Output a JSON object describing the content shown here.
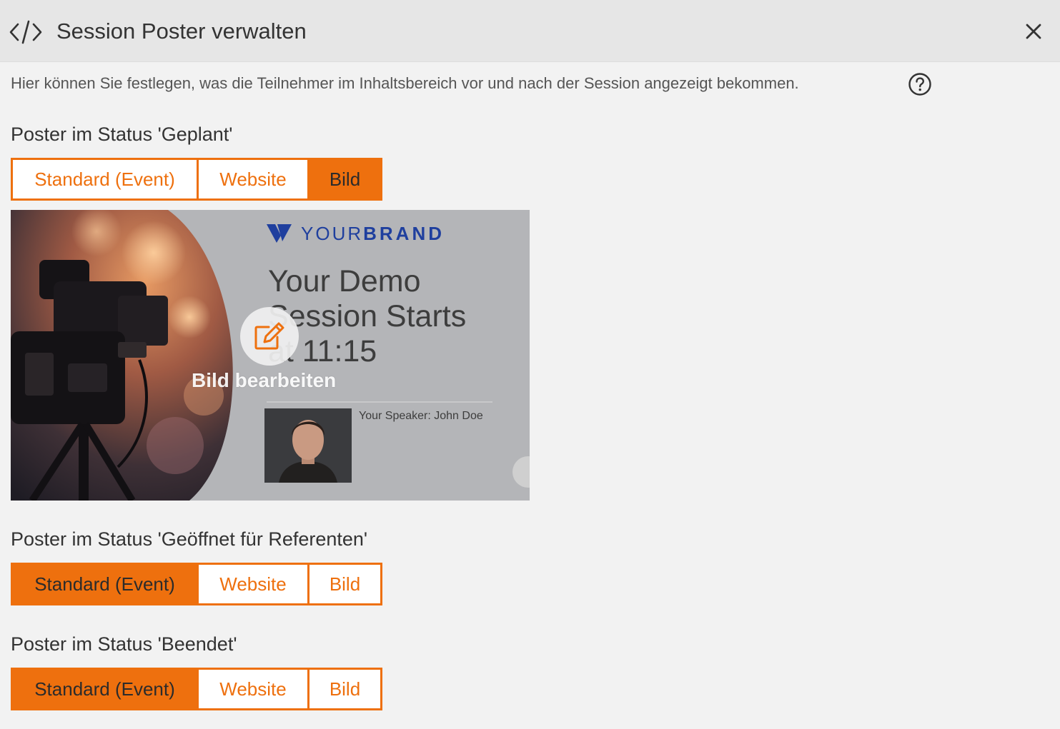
{
  "header": {
    "title": "Session Poster verwalten",
    "code_icon": "code-icon",
    "close_icon": "close-icon"
  },
  "description": "Hier können Sie festlegen, was die Teilnehmer im Inhaltsbereich vor und nach der Session angezeigt bekommen.",
  "help_icon": "help-circle-icon",
  "sections": [
    {
      "title": "Poster im Status 'Geplant'",
      "options": [
        "Standard (Event)",
        "Website",
        "Bild"
      ],
      "selected": "Bild"
    },
    {
      "title": "Poster im Status 'Geöffnet für Referenten'",
      "options": [
        "Standard (Event)",
        "Website",
        "Bild"
      ],
      "selected": "Standard (Event)"
    },
    {
      "title": "Poster im Status 'Beendet'",
      "options": [
        "Standard (Event)",
        "Website",
        "Bild"
      ],
      "selected": "Standard (Event)"
    }
  ],
  "poster": {
    "brand_light": "YOUR",
    "brand_bold": "BRAND",
    "headline": [
      "Your Demo",
      "Session Starts",
      "at 11:15"
    ],
    "speaker": "Your Speaker: John Doe",
    "edit_label": "Bild bearbeiten",
    "edit_icon": "edit-icon"
  },
  "colors": {
    "accent": "#ee700e",
    "header_bg": "#e6e6e6",
    "page_bg": "#f2f2f2",
    "brand_blue": "#1f3f9e"
  }
}
